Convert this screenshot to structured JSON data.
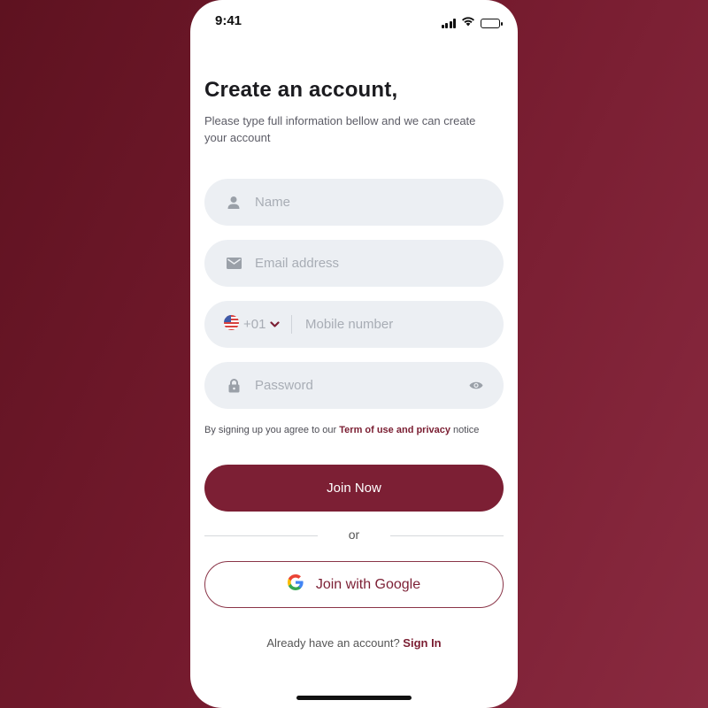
{
  "status_bar": {
    "time": "9:41"
  },
  "header": {
    "title": "Create an account,",
    "subtitle": "Please type full information bellow and we can create your account"
  },
  "form": {
    "name": {
      "placeholder": "Name",
      "value": "",
      "icon": "person-icon"
    },
    "email": {
      "placeholder": "Email address",
      "value": "",
      "icon": "mail-icon"
    },
    "mobile": {
      "country_flag": "us-flag-icon",
      "country_code": "+01",
      "placeholder": "Mobile number",
      "value": ""
    },
    "password": {
      "placeholder": "Password",
      "value": "",
      "icon": "lock-icon",
      "toggle_icon": "eye-icon"
    }
  },
  "terms": {
    "prefix": "By signing up you agree to our ",
    "link": "Term of use and privacy",
    "suffix": " notice"
  },
  "actions": {
    "join_label": "Join Now",
    "divider_label": "or",
    "google_label": "Join with Google",
    "google_icon": "google-icon"
  },
  "footer": {
    "prompt": "Already have an account? ",
    "signin_label": "Sign In"
  },
  "colors": {
    "brand": "#7c1f34",
    "field_bg": "#eceff3",
    "background": "#6a1527"
  }
}
